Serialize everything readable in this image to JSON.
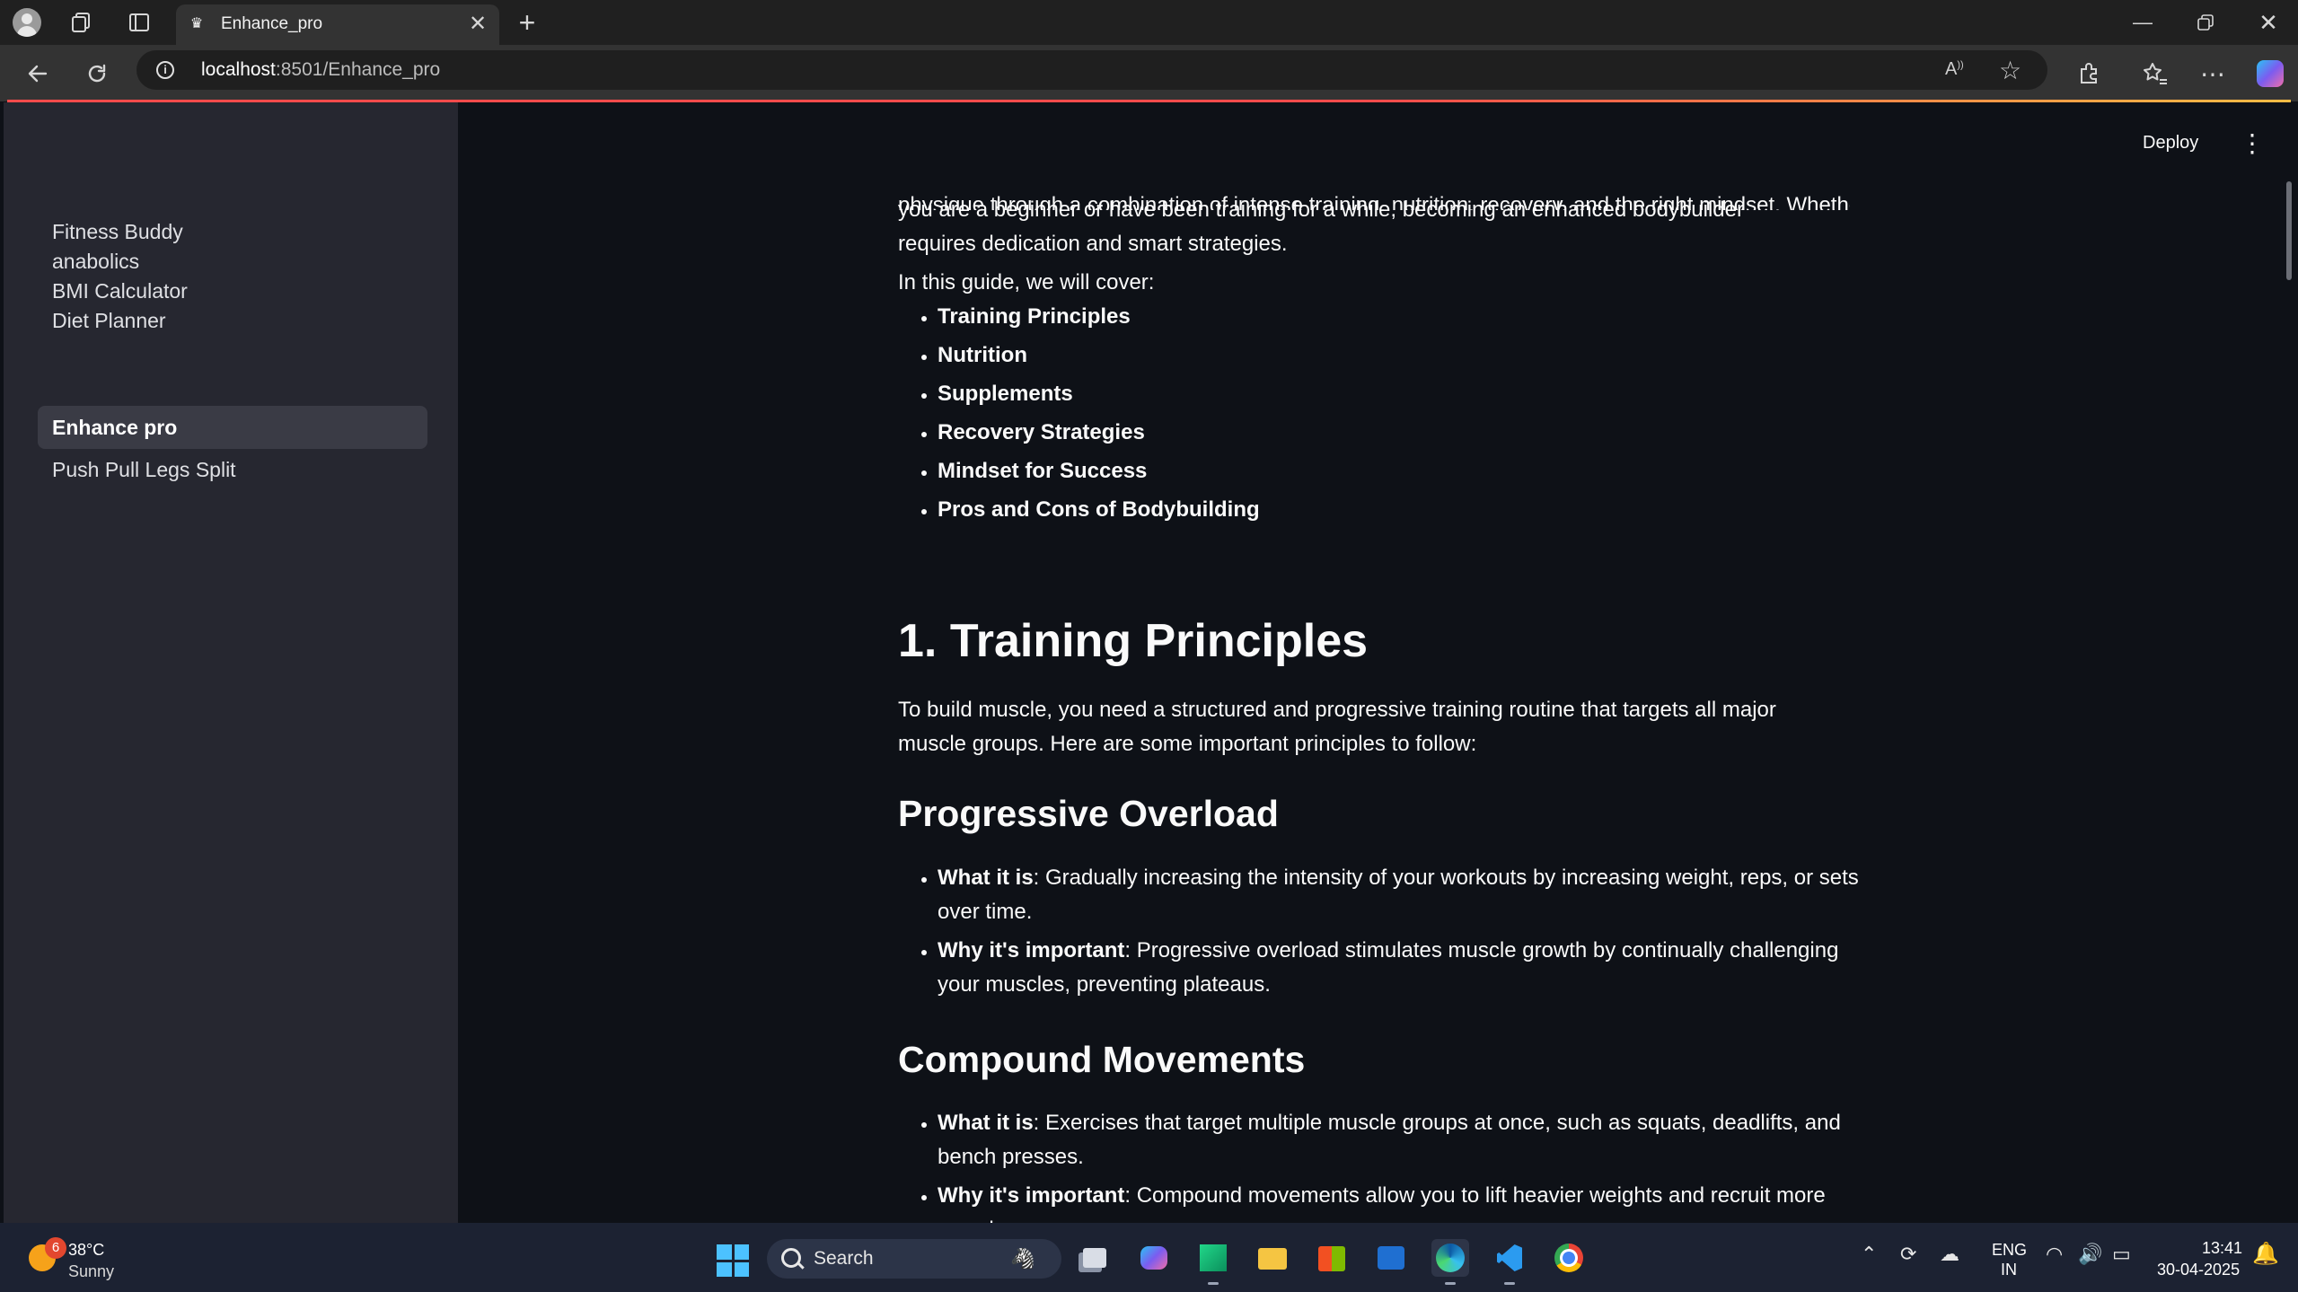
{
  "browser": {
    "tab_title": "Enhance_pro",
    "tab_close": "✕",
    "url_host": "localhost",
    "url_rest": ":8501/Enhance_pro",
    "new_tab": "+",
    "window_controls": {
      "minimize": "—",
      "restore": "❐",
      "close": "✕"
    },
    "icons": [
      "profile-avatar",
      "workspaces-icon",
      "tab-actions-icon",
      "back-icon",
      "refresh-icon",
      "site-info-icon",
      "read-aloud-icon",
      "favorite-star-icon",
      "extensions-icon",
      "favorites-icon",
      "more-icon",
      "copilot-icon"
    ]
  },
  "app": {
    "deploy_label": "Deploy",
    "menu_glyph": "⋮"
  },
  "sidebar": {
    "items": [
      {
        "label": "Fitness Buddy",
        "active": false
      },
      {
        "label": "anabolics",
        "active": false
      },
      {
        "label": "BMI Calculator",
        "active": false
      },
      {
        "label": "Diet Planner",
        "active": false
      },
      {
        "label": "Enhance pro",
        "active": true
      },
      {
        "label": "Push Pull Legs Split",
        "active": false
      }
    ]
  },
  "content": {
    "cut_line": "physique through a combination of intense training, nutrition, recovery, and the right mindset. Whether",
    "intro": "you are a beginner or have been training for a while, becoming an enhanced bodybuilder requires dedication and smart strategies.",
    "cover_intro": "In this guide, we will cover:",
    "cover_list": [
      "Training Principles",
      "Nutrition",
      "Supplements",
      "Recovery Strategies",
      "Mindset for Success",
      "Pros and Cons of Bodybuilding"
    ],
    "section1_heading": "1. Training Principles",
    "section1_text": "To build muscle, you need a structured and progressive training routine that targets all major muscle groups. Here are some important principles to follow:",
    "progressive": {
      "heading": "Progressive Overload",
      "what_label": "What it is",
      "what_text": ": Gradually increasing the intensity of your workouts by increasing weight, reps, or sets over time.",
      "why_label": "Why it's important",
      "why_text": ": Progressive overload stimulates muscle growth by continually challenging your muscles, preventing plateaus."
    },
    "compound": {
      "heading": "Compound Movements",
      "what_label": "What it is",
      "what_text": ": Exercises that target multiple muscle groups at once, such as squats, deadlifts, and bench presses.",
      "why_label": "Why it's important",
      "why_text": ": Compound movements allow you to lift heavier weights and recruit more muscle"
    }
  },
  "taskbar": {
    "weather_badge": "6",
    "weather_temp": "38°C",
    "weather_condition": "Sunny",
    "search_placeholder": "Search",
    "search_highlight": "🦓",
    "apps": [
      "task-view",
      "copilot",
      "pycharm",
      "file-explorer",
      "microsoft-store",
      "outlook",
      "edge",
      "vscode",
      "chrome"
    ],
    "tray_chevron": "⌃",
    "tray_sync": "⟳",
    "tray_onedrive": "☁",
    "lang_line1": "ENG",
    "lang_line2": "IN",
    "tray_wifi": "◠",
    "tray_volume": "🔊",
    "tray_battery": "▭",
    "time": "13:41",
    "date": "30-04-2025",
    "notifications_glyph": "🔔"
  }
}
